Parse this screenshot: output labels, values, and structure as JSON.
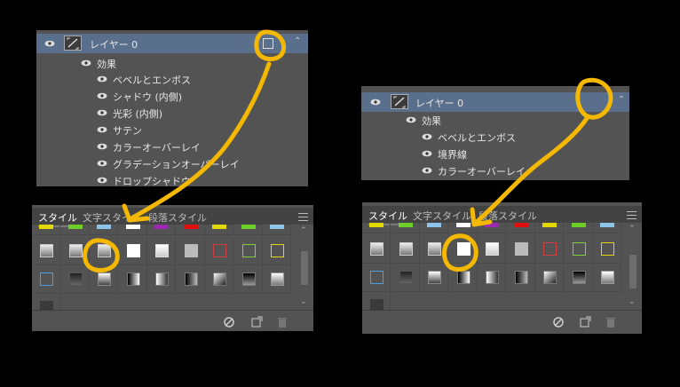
{
  "left_layers": {
    "layer_name": "レイヤー 0",
    "effects_label": "効果",
    "effects": [
      "ベベルとエンボス",
      "シャドウ (内側)",
      "光彩 (内側)",
      "サテン",
      "カラーオーバーレイ",
      "グラデーションオーバーレイ",
      "ドロップシャドウ"
    ],
    "fx_icon": "fx-badge-icon"
  },
  "right_layers": {
    "layer_name": "レイヤー 0",
    "effects_label": "効果",
    "effects": [
      "ベベルとエンボス",
      "境界線",
      "カラーオーバーレイ"
    ]
  },
  "styles_panel": {
    "tabs": [
      "スタイル",
      "文字スタイル",
      "段落スタイル"
    ],
    "active_tab": "スタイル",
    "footer_icons": [
      "clear-style-icon",
      "new-style-icon",
      "trash-icon"
    ]
  },
  "colors": {
    "annotation": "#f4b800",
    "selected_row": "#5a6f8c",
    "panel_bg": "#535353"
  }
}
